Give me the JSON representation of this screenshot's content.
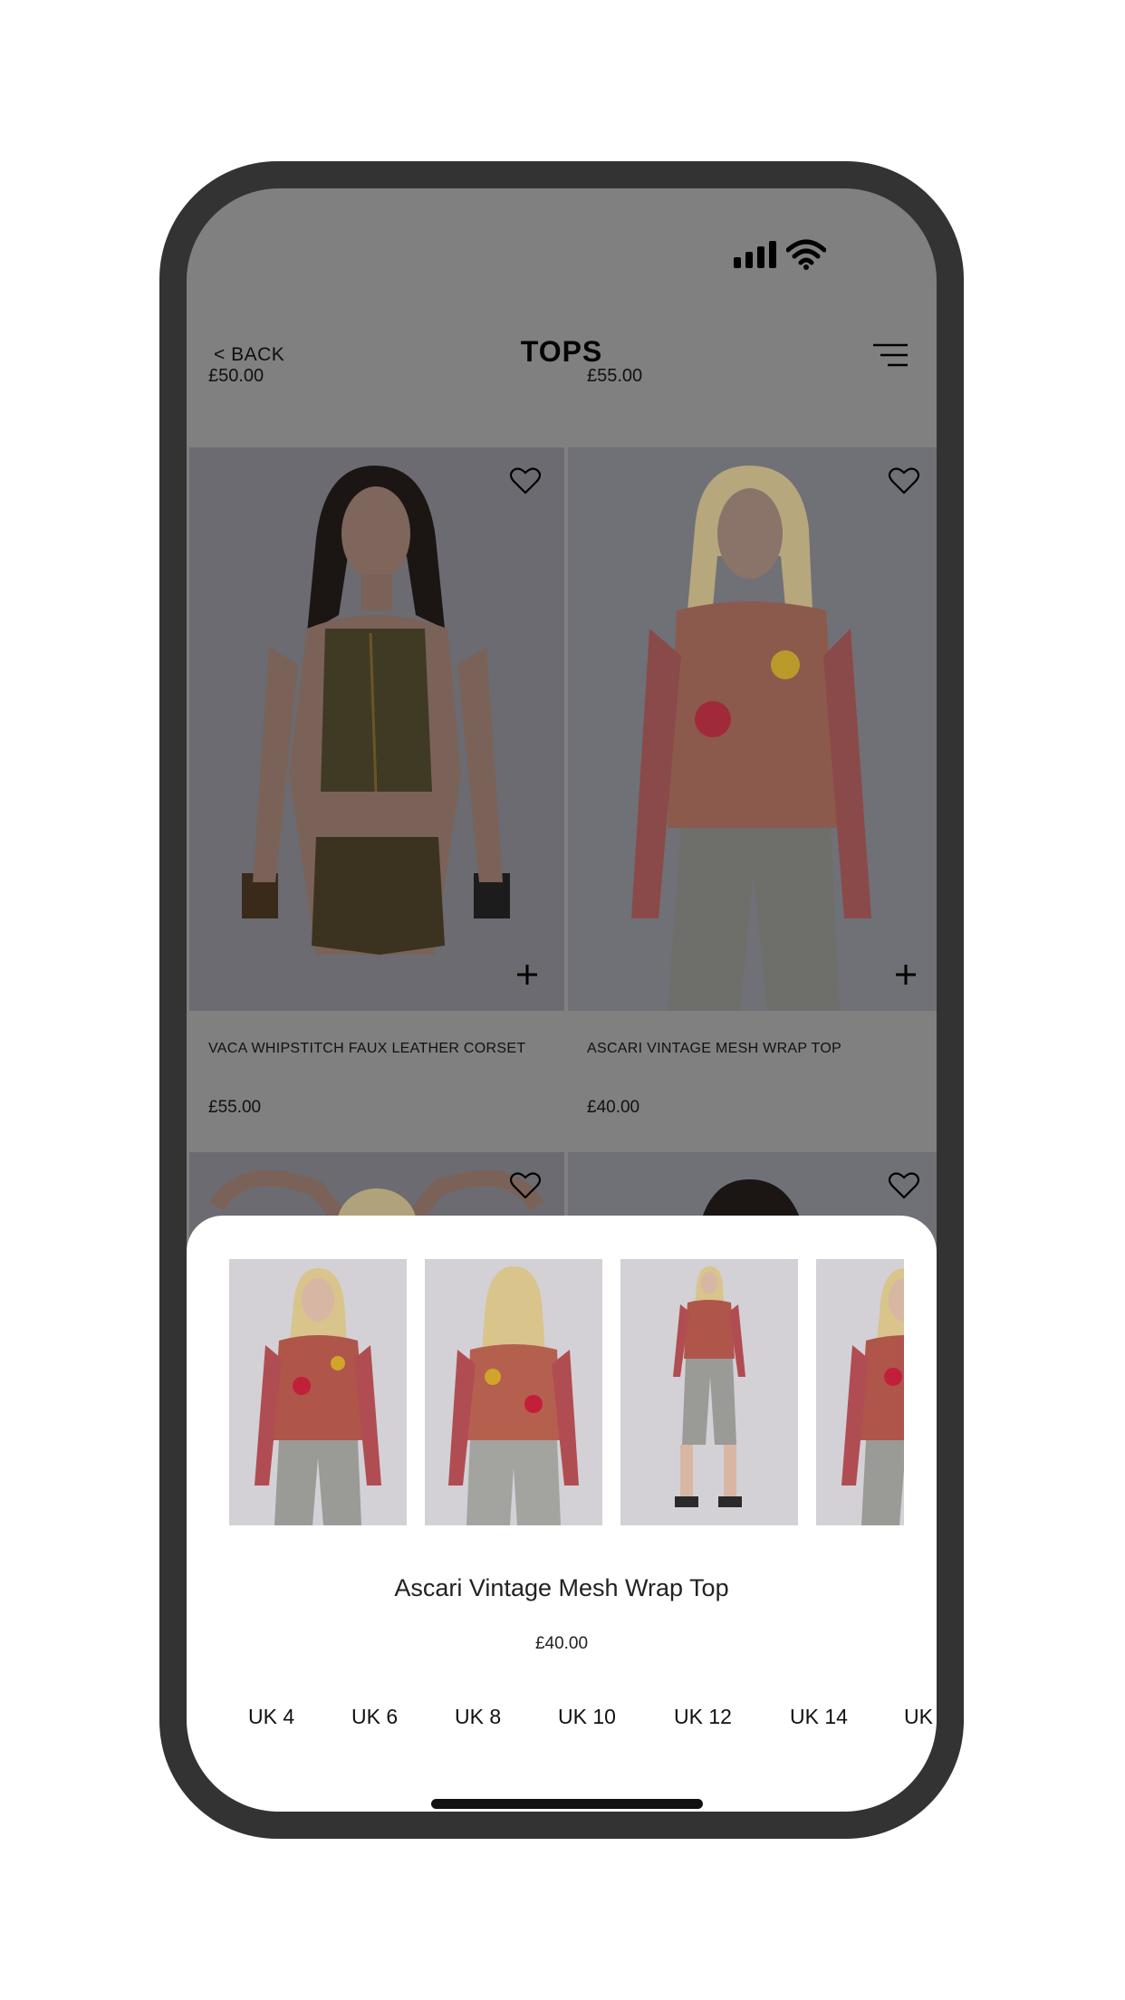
{
  "colors": {
    "overlay_bg": "#808080",
    "frame": "#333333",
    "sheet_bg": "#ffffff",
    "text": "#111111"
  },
  "status": {
    "signal_icon": "signal-icon",
    "wifi_icon": "wifi-icon"
  },
  "nav": {
    "back_label": "< BACK",
    "title": "TOPS",
    "menu_icon": "filter-menu-icon"
  },
  "grid": {
    "previous_row_prices": [
      "£50.00",
      "£55.00"
    ],
    "products": [
      {
        "name": "VACA WHIPSTITCH FAUX LEATHER CORSET",
        "price": "£55.00"
      },
      {
        "name": "ASCARI VINTAGE MESH WRAP TOP",
        "price": "£40.00"
      }
    ]
  },
  "sheet": {
    "product_name": "Ascari Vintage Mesh Wrap Top",
    "price": "£40.00",
    "sizes": [
      "UK 4",
      "UK 6",
      "UK 8",
      "UK 10",
      "UK 12",
      "UK 14",
      "UK"
    ]
  }
}
